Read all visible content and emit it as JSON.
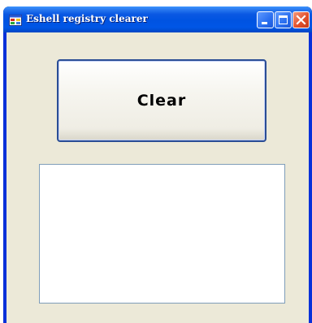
{
  "window": {
    "title": "Eshell registry clearer",
    "icon": "app-window-icon",
    "controls": [
      "minimize-icon",
      "maximize-icon",
      "close-icon"
    ]
  },
  "main": {
    "clear_button_label": "Clear",
    "output_text": ""
  },
  "colors": {
    "titlebar": "#0053e1",
    "client_background": "#ece9d8",
    "button_border": "#2a4d95",
    "close_button": "#e2512c"
  }
}
